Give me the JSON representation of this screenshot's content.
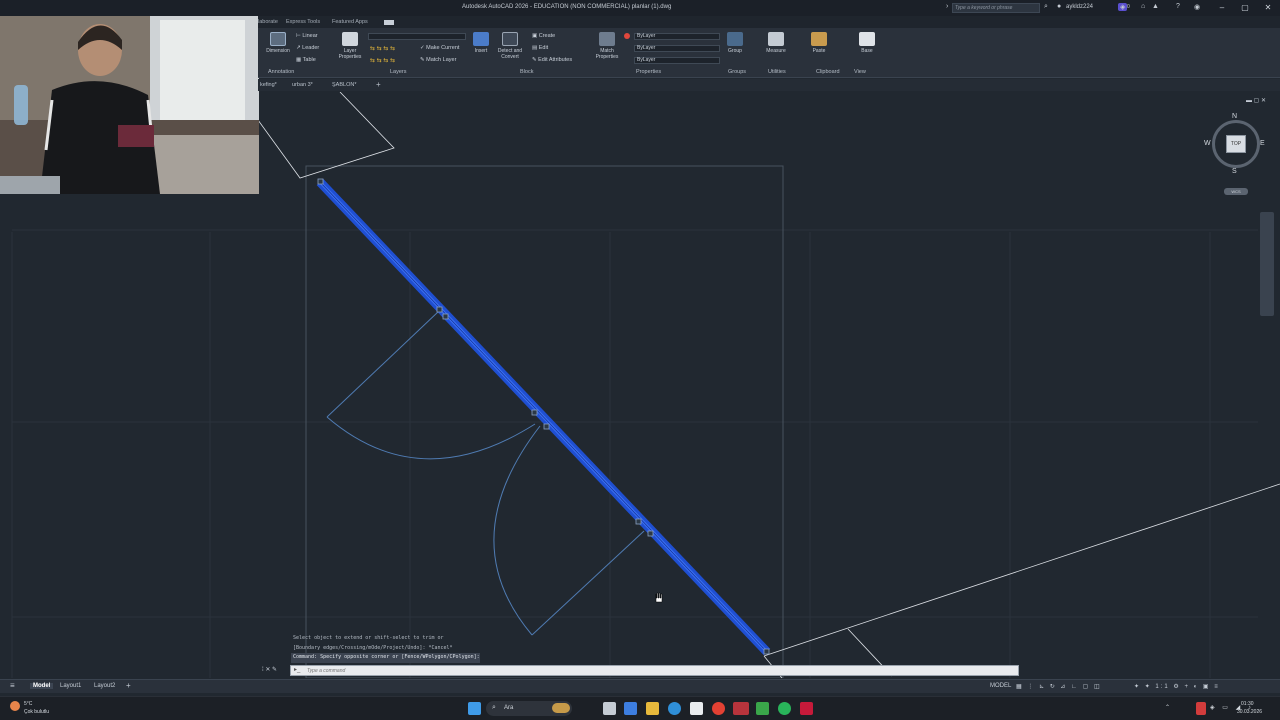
{
  "app": {
    "title": "Autodesk AutoCAD 2026 - EDUCATION (NON COMMERCIAL)   planlar (1).dwg",
    "search_placeholder": "Type a keyword or phrase",
    "user": "aykldz224",
    "notification_count": "0"
  },
  "ribbon_tabs": [
    "laborate",
    "Express Tools",
    "Featured Apps"
  ],
  "ribbon": {
    "annotation": {
      "dimension": "Dimension",
      "linear": "Linear",
      "leader": "Leader",
      "table": "Table",
      "label": "Annotation"
    },
    "layers": {
      "layer_properties": "Layer Properties",
      "make_current": "Make Current",
      "match_layer": "Match Layer",
      "label": "Layers"
    },
    "block": {
      "insert": "Insert",
      "detect_and_convert": "Detect and Convert",
      "create": "Create",
      "edit": "Edit",
      "edit_attributes": "Edit Attributes",
      "label": "Block"
    },
    "properties": {
      "match_properties": "Match Properties",
      "color": "ByLayer",
      "linetype": "ByLayer",
      "lineweight": "ByLayer",
      "label": "Properties"
    },
    "groups": {
      "group": "Group",
      "label": "Groups"
    },
    "utilities": {
      "measure": "Measure",
      "label": "Utilities"
    },
    "clipboard": {
      "paste": "Paste",
      "label": "Clipboard"
    },
    "view": {
      "base": "Base",
      "label": "View"
    }
  },
  "doc_tabs": [
    "kefing*",
    "urban 3*",
    "ŞABLON*"
  ],
  "viewcube": {
    "n": "N",
    "s": "S",
    "e": "E",
    "w": "W",
    "face": "TOP",
    "ucs": "WCS"
  },
  "command": {
    "history": [
      "Select object to extend or shift-select to trim or",
      "[Boundary edges/Crossing/mOde/Project/Undo]: *Cancel*",
      "Command: Specify opposite corner or [Fence/WPolygon/CPolygon]:"
    ],
    "placeholder": "Type a command"
  },
  "layout_tabs": [
    "Model",
    "Layout1",
    "Layout2"
  ],
  "status": {
    "model_label": "MODEL"
  },
  "taskbar": {
    "weather_temp": "5°C",
    "weather_text": "Çok bulutlu",
    "search_label": "Ara",
    "clock_time": "01:30",
    "clock_date": "30.03.2026"
  },
  "colors": {
    "background": "#212830",
    "selection_blue": "#1f4fd1",
    "drawing_line": "#4f7bb2",
    "ribbon": "#2a313b"
  }
}
